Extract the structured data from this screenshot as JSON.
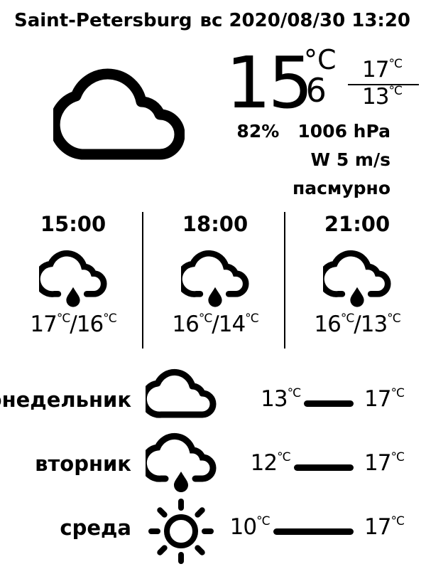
{
  "header": {
    "city": "Saint-Petersburg",
    "datetime": "вс 2020/08/30 13:20"
  },
  "current": {
    "icon": "cloud-icon",
    "temp_int": "15",
    "temp_dec": ",6",
    "unit": "°C",
    "high": "17",
    "low": "13",
    "humidity": "82%",
    "pressure": "1006 hPa",
    "wind": "W 5 m/s",
    "condition": "пасмурно"
  },
  "hourly": [
    {
      "time": "15:00",
      "icon": "rain-cloud-icon",
      "t1": "17",
      "t2": "16"
    },
    {
      "time": "18:00",
      "icon": "rain-cloud-icon",
      "t1": "16",
      "t2": "14"
    },
    {
      "time": "21:00",
      "icon": "rain-cloud-icon",
      "t1": "16",
      "t2": "13"
    }
  ],
  "daily": [
    {
      "day": "понедельник",
      "icon": "cloud-icon",
      "min": 13,
      "max": 17
    },
    {
      "day": "вторник",
      "icon": "rain-cloud-icon",
      "min": 12,
      "max": 17
    },
    {
      "day": "среда",
      "icon": "sun-icon",
      "min": 10,
      "max": 17
    }
  ],
  "unit_short": "°C",
  "slash": "/"
}
